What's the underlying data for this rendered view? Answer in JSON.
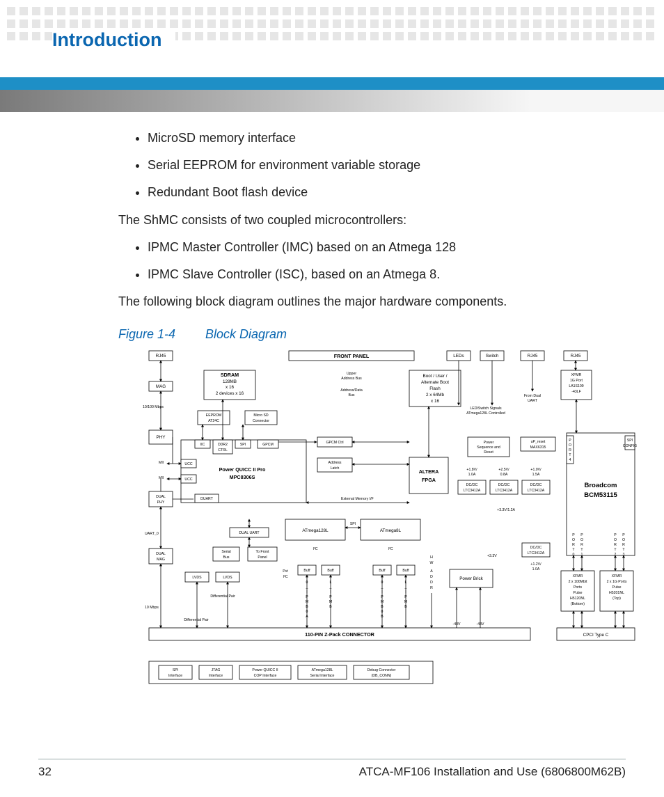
{
  "header": {
    "section_title": "Introduction"
  },
  "body": {
    "bullets_a": [
      "MicroSD memory interface",
      "Serial EEPROM for environment variable storage",
      "Redundant Boot flash device"
    ],
    "para_a": "The ShMC consists of two coupled microcontrollers:",
    "bullets_b": [
      "IPMC Master Controller (IMC) based on an Atmega 128",
      "IPMC Slave Controller (ISC), based on an Atmega 8."
    ],
    "para_b": "The following block diagram outlines the major hardware components.",
    "figure_label": "Figure 1-4",
    "figure_title": "Block Diagram"
  },
  "diagram": {
    "front_panel": "FRONT PANEL",
    "rj45": "RJ45",
    "mag": "MAG",
    "leds": "LEDs",
    "switch": "Switch",
    "rate_10_100": "10/100 Mbps",
    "sdram": [
      "SDRAM",
      "128MB",
      "x 16",
      "2 devices x 16"
    ],
    "eeprom": [
      "EEPROM",
      "AT24C"
    ],
    "microsd": [
      "Micro SD",
      "Connector"
    ],
    "upper_addr": [
      "Upper",
      "Address Bus"
    ],
    "addr_data": [
      "Address/Data",
      "Bus"
    ],
    "boot_flash": [
      "Boot / User /",
      "Alternate Boot",
      "Flash",
      "2 x 64Mb",
      "x 16"
    ],
    "led_sw_sig": [
      "LED/Switch Signals",
      "ATmega128L Controlled"
    ],
    "from_dual_uart": [
      "From Dual",
      "UART"
    ],
    "xfmr_1g": [
      "XFMR",
      "1G Port",
      "LA1S109",
      "-43LF"
    ],
    "phy": "PHY",
    "iic": "IIC",
    "ddr2": [
      "DDR2",
      "CTRL"
    ],
    "spi": "SPI",
    "gpcm": "GPCM",
    "gpcm_ctrl": "GPCM Ctrl",
    "addr_latch": [
      "Address",
      "Latch"
    ],
    "pq_title": [
      "Power QUICC II Pro",
      "MPC8306S"
    ],
    "mii": "MII",
    "ucc": "UCC",
    "altera": [
      "ALTERA",
      "FPGA"
    ],
    "pwr_seq": [
      "Power",
      "Sequence and",
      "Reset"
    ],
    "up_reset": [
      "uP_reset",
      "MAX6315"
    ],
    "port4": [
      "P",
      "O",
      "R",
      "T",
      "4"
    ],
    "spi_config": [
      "SPI",
      "CONFIG"
    ],
    "broadcom": [
      "Broadcom",
      "BCM53115"
    ],
    "dcdc": [
      "DC/DC",
      "LTC3412A"
    ],
    "v18": [
      "+1.8V/",
      "1.0A"
    ],
    "v25": [
      "+2.5V/",
      "0.8A"
    ],
    "v10": [
      "+1.0V/",
      "1.5A"
    ],
    "v33_12a": "+3.3V/1.2A",
    "v33": "+3.3V",
    "v12": [
      "+1.2V/",
      "1.0A"
    ],
    "dual_phy": [
      "DUAL",
      "PHY"
    ],
    "duart": "DUART",
    "dual_uart_box": "DUAL UART",
    "ext_mem_if": "External Memory I/F",
    "uart0": "UART_0",
    "serial_bus": [
      "Serial",
      "Bus"
    ],
    "to_front_panel": [
      "To Front",
      "Panel"
    ],
    "atmega128l": "ATmega128L",
    "atmega8l": "ATmega8L",
    "i2c": "I²C",
    "dual_mag": [
      "DUAL",
      "MAG"
    ],
    "lvds": "LVDS",
    "pvt_i2c": [
      "Pvt",
      "I²C"
    ],
    "buff": "Buff",
    "ipmb0a": [
      "0",
      "_",
      "I",
      "P",
      "M",
      "B",
      "0",
      "A"
    ],
    "ipmb0b": [
      "0",
      "_",
      "I",
      "P",
      "M",
      "B",
      "0",
      "B"
    ],
    "lipmb": [
      "L",
      "_",
      "I",
      "P",
      "M",
      "B"
    ],
    "hwaddr": [
      "H",
      "W",
      "A",
      "D",
      "D",
      "R"
    ],
    "power_brick": "Power Brick",
    "n48v": "-48V",
    "diff_pair": "Differential Pair",
    "rate_10mbps": "10 Mbps",
    "zpack": "110-PIN Z-Pack CONNECTOR",
    "cpci": "CPCI Type C",
    "ports_labels": {
      "p": "P",
      "o": "O",
      "r": "R",
      "t": "T",
      "p0": "0",
      "p1": "1",
      "p2": "2",
      "p3": "3"
    },
    "xfmr_bottom": [
      "XFMR",
      "2 x 100Mbit",
      "Ports",
      "Pulse",
      "H5120NL",
      "(Bottom)"
    ],
    "xfmr_top": [
      "XFMR",
      "2 x 1G Ports",
      "Pulse",
      "H5201NL",
      "(Top)"
    ],
    "bottom_boxes": {
      "spi_if": [
        "SPI",
        "Interface"
      ],
      "jtag_if": [
        "JTAG",
        "Interface"
      ],
      "pq_cop": [
        "Power QUICC II",
        "COP Interface"
      ],
      "atmega_serial": [
        "ATmega128L",
        "Serial Interface"
      ],
      "debug_conn": [
        "Debug Connector",
        "(DB_CONN)"
      ]
    }
  },
  "footer": {
    "page_num": "32",
    "doc_title": "ATCA-MF106 Installation and Use (6806800M62B)"
  }
}
